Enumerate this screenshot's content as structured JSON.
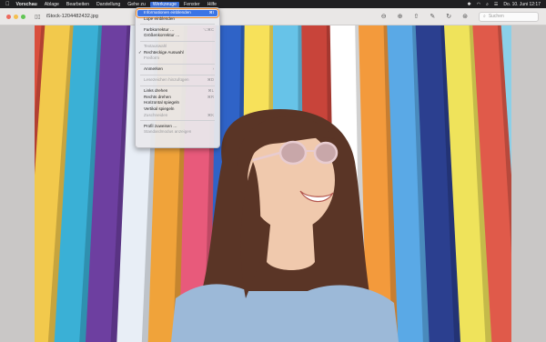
{
  "menubar": {
    "items": [
      "Vorschau",
      "Ablage",
      "Bearbeiten",
      "Darstellung",
      "Gehe zu",
      "Werkzeuge",
      "Fenster",
      "Hilfe"
    ],
    "clock": "Do. 10. Juni  12:17"
  },
  "window": {
    "title": "iStock-1204482432.jpg",
    "search_placeholder": "Suchen"
  },
  "menu": {
    "items": [
      {
        "label": "Informationen einblenden",
        "shortcut": "⌘I",
        "state": "highlighted"
      },
      {
        "label": "Lupe einblenden",
        "shortcut": "",
        "state": "enabled"
      },
      {
        "sep": true
      },
      {
        "label": "Farbkorrektur …",
        "shortcut": "⌥⌘C",
        "state": "enabled"
      },
      {
        "label": "Größenkorrektur …",
        "shortcut": "",
        "state": "enabled"
      },
      {
        "sep": true
      },
      {
        "label": "Textauswahl",
        "shortcut": "",
        "state": "disabled"
      },
      {
        "label": "Rechteckige Auswahl",
        "shortcut": "",
        "state": "checked"
      },
      {
        "label": "Freiform",
        "shortcut": "",
        "state": "disabled"
      },
      {
        "sep": true
      },
      {
        "label": "Anmerken",
        "shortcut": "›",
        "state": "enabled"
      },
      {
        "sep": true
      },
      {
        "label": "Lesezeichen hinzufügen",
        "shortcut": "⌘D",
        "state": "disabled"
      },
      {
        "sep": true
      },
      {
        "label": "Links drehen",
        "shortcut": "⌘L",
        "state": "enabled"
      },
      {
        "label": "Rechts drehen",
        "shortcut": "⌘R",
        "state": "enabled"
      },
      {
        "label": "Horizontal spiegeln",
        "shortcut": "",
        "state": "enabled"
      },
      {
        "label": "Vertikal spiegeln",
        "shortcut": "",
        "state": "enabled"
      },
      {
        "label": "Zuschneiden",
        "shortcut": "⌘K",
        "state": "disabled"
      },
      {
        "sep": true
      },
      {
        "label": "Profil zuweisen …",
        "shortcut": "",
        "state": "enabled"
      },
      {
        "label": "Standardmodus anzeigen",
        "shortcut": "",
        "state": "disabled"
      }
    ]
  },
  "photo": {
    "stripe_colors": [
      "#d94f3d",
      "#f2c94c",
      "#3ab0d6",
      "#6d3fa0",
      "#e8eef6",
      "#f0a33a",
      "#e85a7b",
      "#2f63c7",
      "#f7e15a",
      "#67c3e8",
      "#c8443a",
      "#ffffff",
      "#f39a3c",
      "#5aa9e6",
      "#2b3f8f",
      "#efe35b",
      "#e05a4a",
      "#8bd0e8"
    ],
    "hair_color": "#5a3526",
    "skin_color": "#f0c9ad",
    "top_color": "#9cb9d8"
  }
}
